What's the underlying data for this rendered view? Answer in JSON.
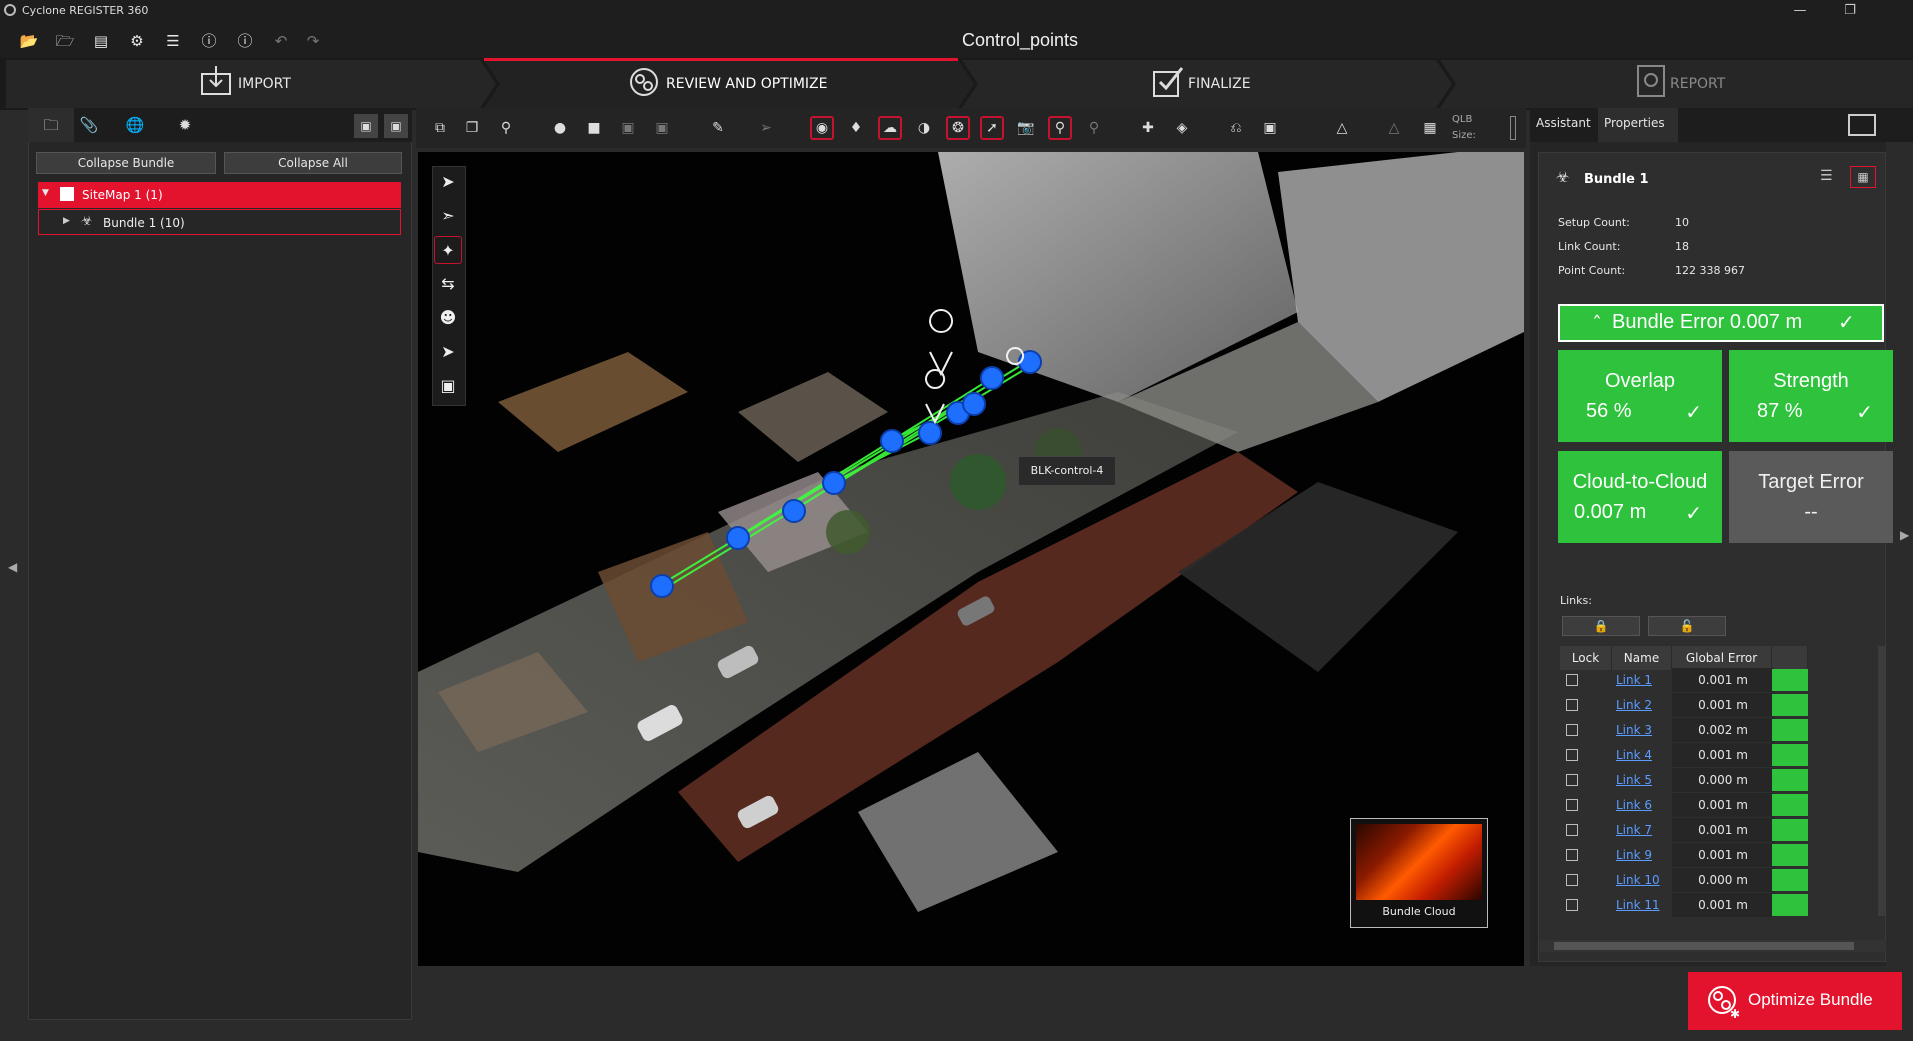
{
  "app": {
    "title": "Cyclone REGISTER 360",
    "project_title": "Control_points"
  },
  "toolbar": {
    "icons": [
      "open-folder-icon",
      "open-project-icon",
      "scanner-icon",
      "settings-gear-icon",
      "database-icon",
      "help-icon",
      "info-icon",
      "undo-icon",
      "redo-icon"
    ]
  },
  "window_controls": {
    "minimize": "—",
    "restore": "❐"
  },
  "steps": [
    {
      "label": "IMPORT",
      "active": false
    },
    {
      "label": "REVIEW AND OPTIMIZE",
      "active": true
    },
    {
      "label": "FINALIZE",
      "active": false
    },
    {
      "label": "REPORT",
      "active": false
    }
  ],
  "left_panel": {
    "tabs": [
      "project-tab-icon",
      "attachment-tab-icon",
      "globe-tab-icon",
      "settings-tab-icon"
    ],
    "buttons": {
      "collapse_bundle": "Collapse Bundle",
      "collapse_all": "Collapse All"
    },
    "tree": [
      {
        "label": "SiteMap 1 (1)",
        "selected": true
      },
      {
        "label": "Bundle 1 (10)",
        "selected": false
      }
    ]
  },
  "viewport": {
    "tooltip": "BLK-control-4",
    "minimap_label": "Bundle Cloud",
    "qlb_label_1": "QLB",
    "qlb_label_2": "Size:"
  },
  "right_panel": {
    "tabs": {
      "assistant": "Assistant",
      "properties": "Properties"
    },
    "bundle_name": "Bundle 1",
    "stats": [
      {
        "label": "Setup Count:",
        "value": "10"
      },
      {
        "label": "Link Count:",
        "value": "18"
      },
      {
        "label": "Point Count:",
        "value": "122 338 967"
      }
    ],
    "bundle_error": "Bundle Error 0.007 m",
    "cards": {
      "overlap_title": "Overlap",
      "overlap_value": "56 %",
      "strength_title": "Strength",
      "strength_value": "87 %",
      "c2c_title": "Cloud-to-Cloud",
      "c2c_value": "0.007 m",
      "target_title": "Target Error",
      "target_value": "--"
    },
    "check": "✓",
    "links_label": "Links:",
    "table_headers": {
      "lock": "Lock",
      "name": "Name",
      "global_error": "Global Error"
    },
    "links": [
      {
        "name": "Link 1",
        "error": "0.001 m"
      },
      {
        "name": "Link 2",
        "error": "0.001 m"
      },
      {
        "name": "Link 3",
        "error": "0.002 m"
      },
      {
        "name": "Link 4",
        "error": "0.001 m"
      },
      {
        "name": "Link 5",
        "error": "0.000 m"
      },
      {
        "name": "Link 6",
        "error": "0.001 m"
      },
      {
        "name": "Link 7",
        "error": "0.001 m"
      },
      {
        "name": "Link 9",
        "error": "0.001 m"
      },
      {
        "name": "Link 10",
        "error": "0.000 m"
      },
      {
        "name": "Link 11",
        "error": "0.001 m"
      }
    ]
  },
  "optimize_button": "Optimize Bundle",
  "colors": {
    "accent": "#e3122d",
    "ok_green": "#2ec23d",
    "link_blue": "#5a9cff",
    "node_blue": "#1f6fff"
  }
}
